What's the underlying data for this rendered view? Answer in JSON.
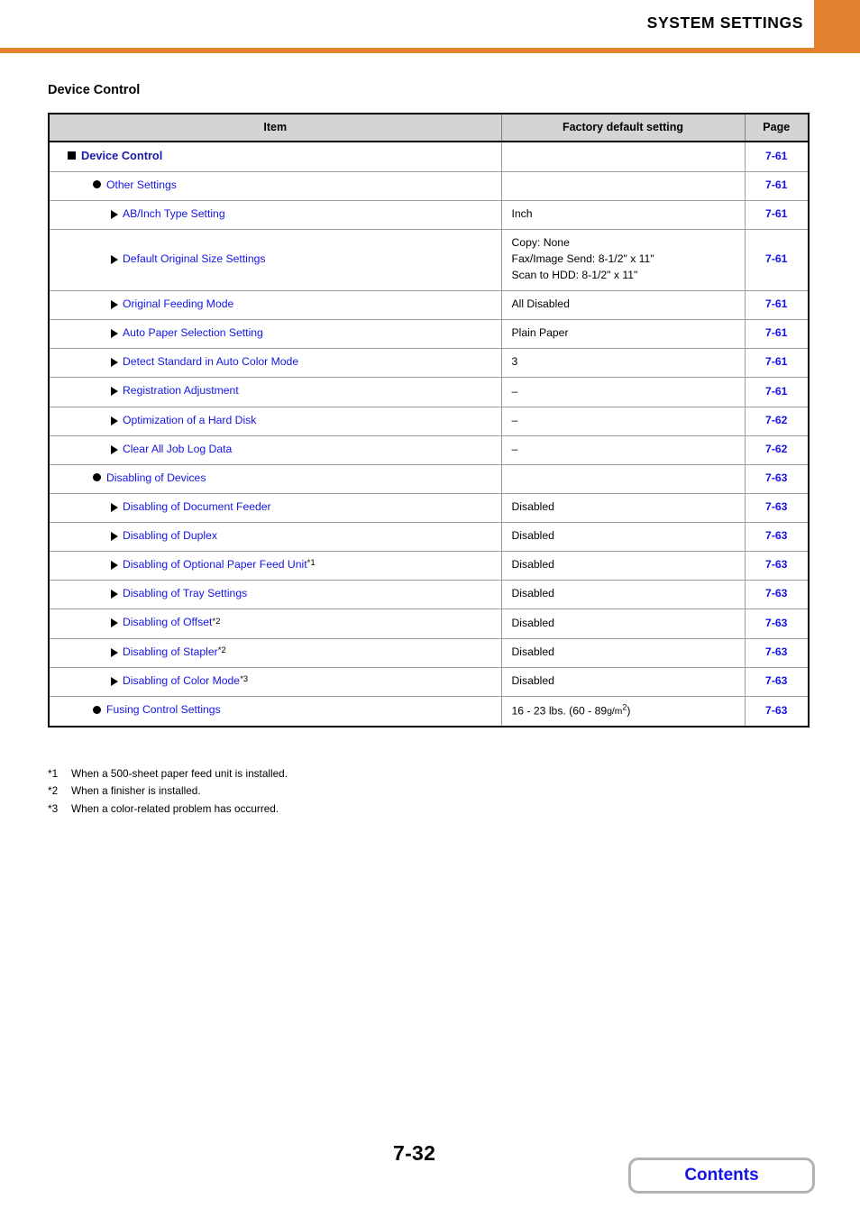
{
  "header": {
    "title": "SYSTEM SETTINGS",
    "accent_color": "#e4812f"
  },
  "section": {
    "title": "Device Control"
  },
  "table": {
    "columns": {
      "item": "Item",
      "value": "Factory default setting",
      "page": "Page"
    },
    "rows": [
      {
        "level": 1,
        "bullet": "square",
        "label": "Device Control",
        "value": "",
        "page": "7-61"
      },
      {
        "level": 2,
        "bullet": "circle",
        "label": "Other Settings",
        "value": "",
        "page": "7-61"
      },
      {
        "level": 3,
        "bullet": "triangle",
        "label": "AB/Inch Type Setting",
        "value": "Inch",
        "page": "7-61"
      },
      {
        "level": 3,
        "bullet": "triangle",
        "label": "Default Original Size Settings",
        "value_lines": [
          "Copy: None",
          "Fax/Image Send: 8-1/2\" x 11\"",
          "Scan to HDD: 8-1/2\" x 11\""
        ],
        "page": "7-61"
      },
      {
        "level": 3,
        "bullet": "triangle",
        "label": "Original Feeding Mode",
        "value": "All Disabled",
        "page": "7-61"
      },
      {
        "level": 3,
        "bullet": "triangle",
        "label": "Auto Paper Selection Setting",
        "value": "Plain Paper",
        "page": "7-61"
      },
      {
        "level": 3,
        "bullet": "triangle",
        "label": "Detect Standard in Auto Color Mode",
        "value": "3",
        "page": "7-61"
      },
      {
        "level": 3,
        "bullet": "triangle",
        "label": "Registration Adjustment",
        "value": "–",
        "page": "7-61"
      },
      {
        "level": 3,
        "bullet": "triangle",
        "label": "Optimization of a Hard Disk",
        "value": "–",
        "page": "7-62"
      },
      {
        "level": 3,
        "bullet": "triangle",
        "label": "Clear All Job Log Data",
        "value": "–",
        "page": "7-62"
      },
      {
        "level": 2,
        "bullet": "circle",
        "label": "Disabling of Devices",
        "value": "",
        "page": "7-63"
      },
      {
        "level": 3,
        "bullet": "triangle",
        "label": "Disabling of Document Feeder",
        "value": "Disabled",
        "page": "7-63"
      },
      {
        "level": 3,
        "bullet": "triangle",
        "label": "Disabling of Duplex",
        "value": "Disabled",
        "page": "7-63"
      },
      {
        "level": 3,
        "bullet": "triangle",
        "label": "Disabling of Optional Paper Feed Unit",
        "footnote": "*1",
        "value": "Disabled",
        "page": "7-63"
      },
      {
        "level": 3,
        "bullet": "triangle",
        "label": "Disabling of Tray Settings",
        "value": "Disabled",
        "page": "7-63"
      },
      {
        "level": 3,
        "bullet": "triangle",
        "label": "Disabling of Offset",
        "footnote": "*2",
        "value": "Disabled",
        "page": "7-63"
      },
      {
        "level": 3,
        "bullet": "triangle",
        "label": "Disabling of Stapler",
        "footnote": "*2",
        "value": "Disabled",
        "page": "7-63"
      },
      {
        "level": 3,
        "bullet": "triangle",
        "label": "Disabling of Color Mode",
        "footnote": "*3",
        "value": "Disabled",
        "page": "7-63"
      },
      {
        "level": 2,
        "bullet": "circle",
        "label": "Fusing Control Settings",
        "value_html": "16 - 23 lbs. (60 - 89<span class=\"unit-small\">g/m<span class=\"sup\">2</span></span>)",
        "page": "7-63"
      }
    ]
  },
  "footnotes": [
    {
      "marker": "*1",
      "text": "When a 500-sheet paper feed unit is installed."
    },
    {
      "marker": "*2",
      "text": "When a finisher is installed."
    },
    {
      "marker": "*3",
      "text": "When a color-related problem has occurred."
    }
  ],
  "footer": {
    "page_number": "7-32",
    "contents_label": "Contents"
  }
}
